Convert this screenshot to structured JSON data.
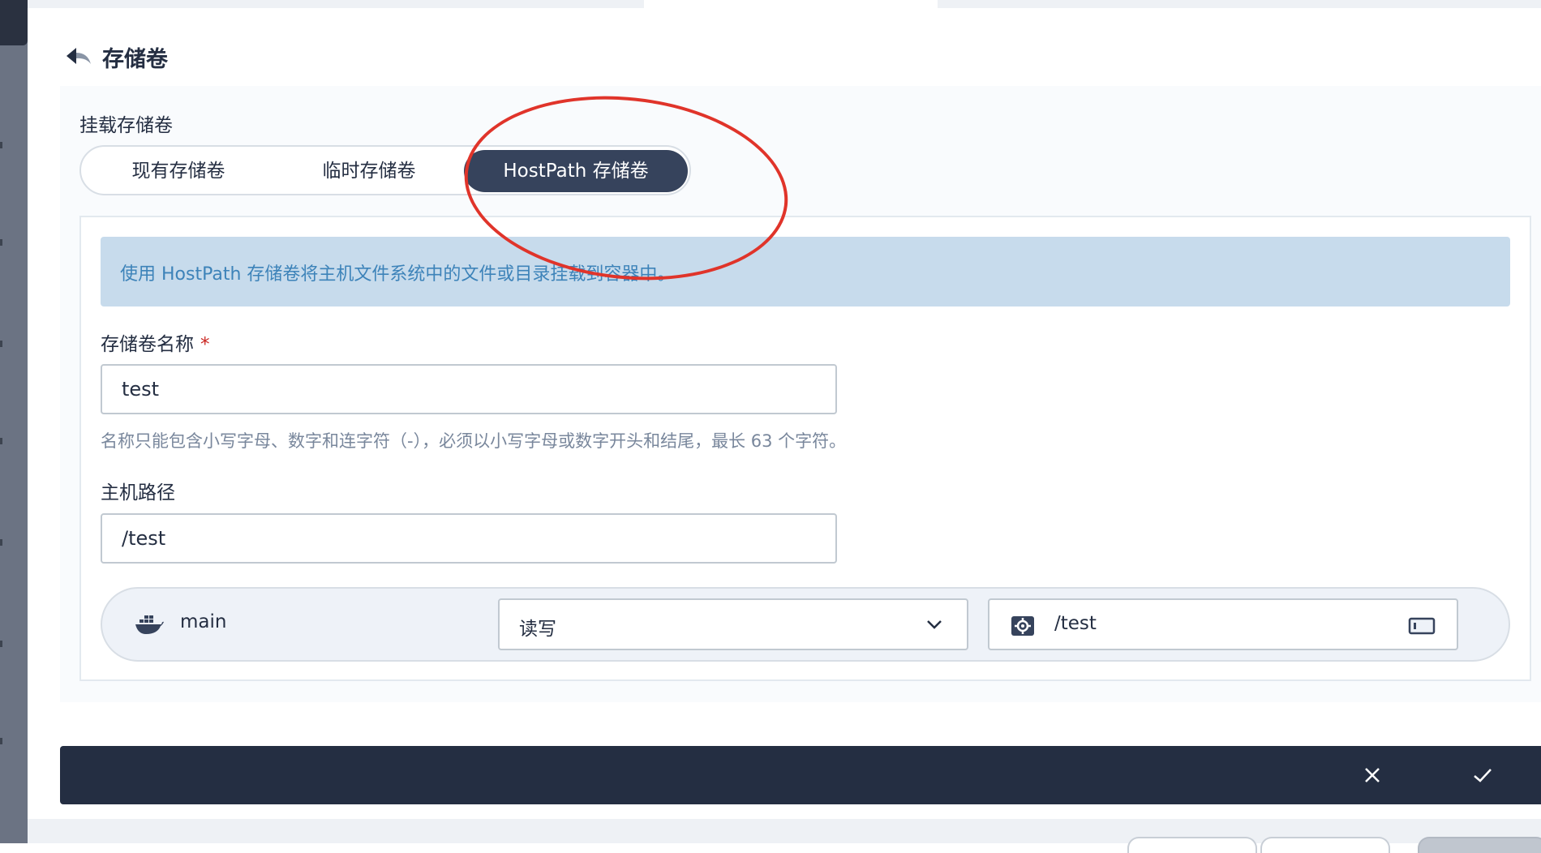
{
  "header": {
    "title": "存储卷"
  },
  "section": {
    "label": "挂载存储卷"
  },
  "tabs": [
    {
      "label": "现有存储卷",
      "active": false
    },
    {
      "label": "临时存储卷",
      "active": false
    },
    {
      "label": "HostPath 存储卷",
      "active": true
    }
  ],
  "info": {
    "text": "使用 HostPath 存储卷将主机文件系统中的文件或目录挂载到容器中。"
  },
  "form": {
    "volume_name_label": "存储卷名称",
    "required_mark": "*",
    "volume_name_value": "test",
    "volume_name_hint": "名称只能包含小写字母、数字和连字符（-），必须以小写字母或数字开头和结尾，最长 63 个字符。",
    "host_path_label": "主机路径",
    "host_path_value": "/test"
  },
  "mount": {
    "container_icon": "docker-icon",
    "container_name": "main",
    "access_mode": "读写",
    "mount_path": "/test"
  },
  "footer": {
    "cancel_icon": "close-icon",
    "confirm_icon": "check-icon"
  },
  "colors": {
    "primary_dark": "#242e42",
    "tab_active": "#36435c",
    "info_bg": "#c7dbec",
    "info_text": "#3d83b9",
    "required": "#ca2621",
    "annotation": "#e0342a"
  }
}
